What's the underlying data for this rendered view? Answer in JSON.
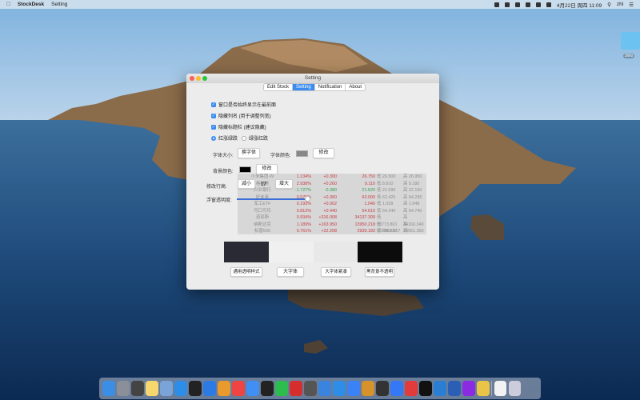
{
  "menubar": {
    "app_name": "StockDesk",
    "menu_item": "Setting",
    "datetime": "4月22日 周四 11:09",
    "user": "zhl"
  },
  "desktop": {
    "folder_label": "zhlio"
  },
  "window": {
    "title": "Setting",
    "tabs": [
      {
        "label": "Edit Stock"
      },
      {
        "label": "Setting",
        "active": true
      },
      {
        "label": "Notification"
      },
      {
        "label": "About"
      }
    ],
    "checkboxes": [
      {
        "label": "窗口是否始终显示在最前面",
        "checked": true
      },
      {
        "label": "隐藏列名 (用于调整列宽)",
        "checked": true
      },
      {
        "label": "隐藏标题栏 (建议隐藏)",
        "checked": true
      }
    ],
    "radios": [
      {
        "label": "红涨绿跌",
        "selected": true
      },
      {
        "label": "绿涨红跌",
        "selected": false
      }
    ],
    "font_size_label": "字体大小:",
    "font_change_btn": "换字体",
    "font_color_label": "字体颜色:",
    "font_color": "#888888",
    "font_color_btn": "修改",
    "bg_color_label": "背景颜色:",
    "bg_color": "#000000",
    "bg_color_btn": "修改",
    "row_height_label": "修改行高:",
    "decrease_btn": "减小",
    "row_height_value": "17",
    "increase_btn": "增大",
    "opacity_label": "浮窗透明度:",
    "opacity_value": 0.4,
    "presets": [
      {
        "label": "通用透明样式"
      },
      {
        "label": "大字体"
      },
      {
        "label": "大字体紧凑"
      },
      {
        "label": "黑背景不透明"
      }
    ]
  },
  "stocks": [
    {
      "name": "小米集团-W",
      "pct": "1.134%",
      "chg": "+0.300",
      "price": "26.750",
      "low": "低 26.500",
      "high": "高 26.950",
      "dir": "up"
    },
    {
      "name": "格林美",
      "pct": "2.938%",
      "chg": "+0.260",
      "price": "9.110",
      "low": "低 8.810",
      "high": "高 9.180",
      "dir": "up"
    },
    {
      "name": "兴业银行",
      "pct": "-1.727%",
      "chg": "-0.380",
      "price": "21.620",
      "low": "低 21.590",
      "high": "高 22.150",
      "dir": "down"
    },
    {
      "name": "好未来",
      "pct": "0.575%",
      "chg": "+0.360",
      "price": "63.000",
      "low": "低 62.420",
      "high": "高 64.295",
      "dir": "up"
    },
    {
      "name": "军工ETF",
      "pct": "0.193%",
      "chg": "+0.002",
      "price": "1.040",
      "low": "低 1.039",
      "high": "高 1.048",
      "dir": "up"
    },
    {
      "name": "可口可乐",
      "pct": "0.812%",
      "chg": "+0.440",
      "price": "54.610",
      "low": "低 54.240",
      "high": "高 54.740",
      "dir": "up"
    },
    {
      "name": "道琼斯",
      "pct": "0.934%",
      "chg": "+316.008",
      "price": "34137.309",
      "low": "低 33773.801",
      "high": "高 34160.340",
      "dir": "up"
    },
    {
      "name": "纳斯达克",
      "pct": "1.189%",
      "chg": "+163.950",
      "price": "13950.218",
      "low": "低 13706.857",
      "high": "高 13951.350",
      "dir": "up"
    },
    {
      "name": "标普500",
      "pct": "0.761%",
      "chg": "+22.208",
      "price": "2939.183",
      "low": "低 2901.917",
      "high": "高 2942.845",
      "dir": "up"
    }
  ],
  "dock": {
    "icons": [
      "finder",
      "launchpad",
      "mission-control",
      "notes",
      "preview",
      "safari",
      "terminal",
      "xcode",
      "pages",
      "chrome",
      "airmail",
      "qq",
      "wechat",
      "youdao",
      "sublime",
      "keynote",
      "app-store",
      "pencil",
      "books",
      "b-app",
      "maps",
      "xmind",
      "l-app",
      "vscode",
      "word",
      "dictionary",
      "stickies",
      "separator",
      "file",
      "trash"
    ],
    "colors": [
      "#3a8ee6",
      "#8a8f99",
      "#444",
      "#f5d76e",
      "#7aa4d8",
      "#2e8de6",
      "#222",
      "#2c7be5",
      "#e89a2c",
      "#e44",
      "#3f8ff5",
      "#222",
      "#2dbd4e",
      "#d62d2d",
      "#555",
      "#3a84e0",
      "#2e8de6",
      "#3b82f6",
      "#d6932b",
      "#333",
      "#3478f6",
      "#e23b3b",
      "#111",
      "#2a7fd4",
      "#2b5fb5",
      "#8a2be2",
      "#e8c547",
      "#ffffff00",
      "#f2f2f2",
      "#ccd"
    ]
  }
}
